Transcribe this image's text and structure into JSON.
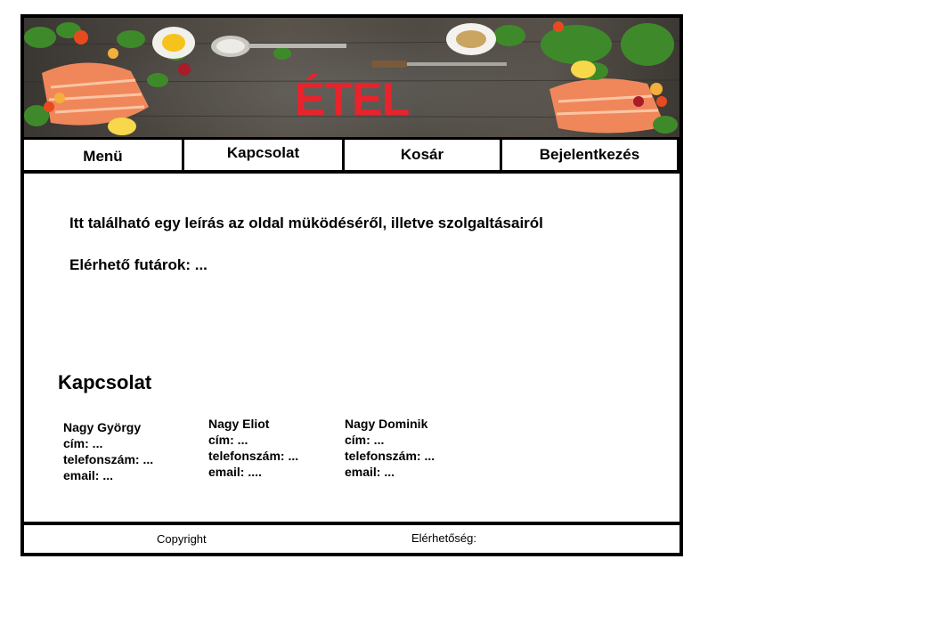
{
  "banner": {
    "title": "ÉTEL"
  },
  "nav": {
    "items": [
      {
        "label": "Menü"
      },
      {
        "label": "Kapcsolat"
      },
      {
        "label": "Kosár"
      },
      {
        "label": "Bejelentkezés"
      }
    ]
  },
  "main": {
    "description": "Itt található egy leírás az oldal müködéséről, illetve szolgaltásairól",
    "couriers": "Elérhető futárok: ..."
  },
  "contact": {
    "title": "Kapcsolat",
    "people": [
      {
        "name": "Nagy György",
        "address": "cím: ...",
        "phone": "telefonszám: ...",
        "email": "email: ..."
      },
      {
        "name": "Nagy Eliot",
        "address": "cím: ...",
        "phone": "telefonszám: ...",
        "email": "email: ...."
      },
      {
        "name": "Nagy Dominik",
        "address": "cím: ...",
        "phone": "telefonszám: ...",
        "email": "email: ..."
      }
    ]
  },
  "footer": {
    "copyright": "Copyright",
    "reach": "Elérhetőség:"
  },
  "colors": {
    "title_red": "#e8232c",
    "border": "#000000",
    "background": "#ffffff"
  }
}
